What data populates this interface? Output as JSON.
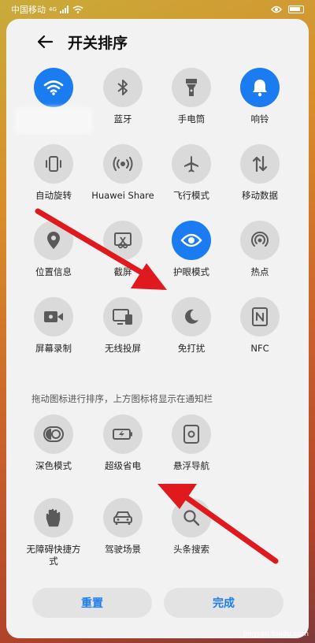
{
  "status_bar": {
    "carrier": "中国移动",
    "signal_tag": "4G"
  },
  "header": {
    "title": "开关排序"
  },
  "tiles": [
    {
      "label": "",
      "icon": "wifi-icon",
      "active": true
    },
    {
      "label": "蓝牙",
      "icon": "bluetooth-icon",
      "active": false
    },
    {
      "label": "手电筒",
      "icon": "flashlight-icon",
      "active": false
    },
    {
      "label": "响铃",
      "icon": "bell-icon",
      "active": true
    },
    {
      "label": "自动旋转",
      "icon": "auto-rotate-icon",
      "active": false
    },
    {
      "label": "Huawei Share",
      "icon": "huawei-share-icon",
      "active": false
    },
    {
      "label": "飞行模式",
      "icon": "airplane-icon",
      "active": false
    },
    {
      "label": "移动数据",
      "icon": "mobile-data-icon",
      "active": false
    },
    {
      "label": "位置信息",
      "icon": "location-icon",
      "active": false
    },
    {
      "label": "截屏",
      "icon": "screenshot-icon",
      "active": false
    },
    {
      "label": "护眼模式",
      "icon": "eye-icon",
      "active": true
    },
    {
      "label": "热点",
      "icon": "hotspot-icon",
      "active": false
    },
    {
      "label": "屏幕录制",
      "icon": "screen-record-icon",
      "active": false
    },
    {
      "label": "无线投屏",
      "icon": "cast-icon",
      "active": false
    },
    {
      "label": "免打扰",
      "icon": "moon-icon",
      "active": false
    },
    {
      "label": "NFC",
      "icon": "nfc-icon",
      "active": false
    }
  ],
  "hint": "拖动图标进行排序，上方图标将显示在通知栏",
  "extra_tiles": [
    {
      "label": "深色模式",
      "icon": "dark-mode-icon"
    },
    {
      "label": "超级省电",
      "icon": "battery-saver-icon"
    },
    {
      "label": "悬浮导航",
      "icon": "floating-nav-icon"
    },
    {
      "label": "无障碍快捷方式",
      "icon": "accessibility-icon"
    },
    {
      "label": "驾驶场景",
      "icon": "car-icon"
    },
    {
      "label": "头条搜索",
      "icon": "search-icon"
    }
  ],
  "buttons": {
    "reset": "重置",
    "done": "完成"
  },
  "watermark": "jingyan.baidu.com",
  "colors": {
    "accent": "#1a7cf0",
    "arrow": "#e0191e"
  }
}
